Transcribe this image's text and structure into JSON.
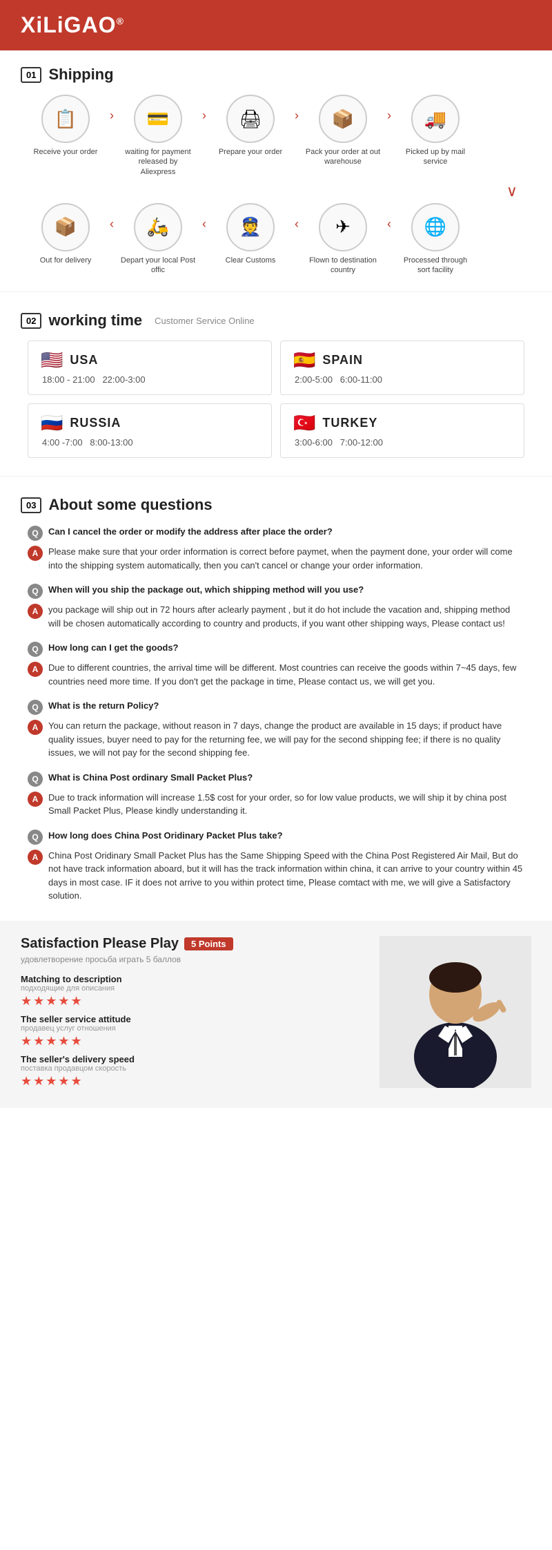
{
  "header": {
    "logo": "XiLiGAO",
    "reg": "®"
  },
  "shipping": {
    "section_num": "01",
    "section_label": "Shipping",
    "row1": [
      {
        "icon": "📋",
        "label": "Receive your order"
      },
      {
        "arrow": "›"
      },
      {
        "icon": "💳",
        "label": "waiting for payment released by Aliexpress"
      },
      {
        "arrow": "›"
      },
      {
        "icon": "🖨",
        "label": "Prepare your order"
      },
      {
        "arrow": "›"
      },
      {
        "icon": "📦",
        "label": "Pack your order at out warehouse"
      },
      {
        "arrow": "›"
      },
      {
        "icon": "🚚",
        "label": "Picked up by mail service"
      }
    ],
    "row2": [
      {
        "icon": "📦",
        "label": "Out for delivery"
      },
      {
        "arrow": "‹"
      },
      {
        "icon": "🛵",
        "label": "Depart your local Post offic"
      },
      {
        "arrow": "‹"
      },
      {
        "icon": "👮",
        "label": "Clear Customs"
      },
      {
        "arrow": "‹"
      },
      {
        "icon": "✈",
        "label": "Flown to destination country"
      },
      {
        "arrow": "‹"
      },
      {
        "icon": "🌐",
        "label": "Processed through sort facility"
      }
    ]
  },
  "working_time": {
    "section_num": "02",
    "section_label": "working time",
    "sublabel": "Customer Service Online",
    "countries": [
      {
        "flag": "🇺🇸",
        "name": "USA",
        "hours": "18:00 - 21:00   22:00-3:00"
      },
      {
        "flag": "🇪🇸",
        "name": "SPAIN",
        "hours": "2:00-5:00   6:00-11:00"
      },
      {
        "flag": "🇷🇺",
        "name": "RUSSIA",
        "hours": "4:00 -7:00   8:00-13:00"
      },
      {
        "flag": "🇹🇷",
        "name": "TURKEY",
        "hours": "3:00-6:00   7:00-12:00"
      }
    ]
  },
  "faq": {
    "section_num": "03",
    "section_label": "About some questions",
    "items": [
      {
        "q": "Can I cancel the order or modify the address after place the order?",
        "a": "Please make sure that your order information is correct before paymet, when the payment done, your order will come into the shipping system automatically, then you can't cancel or change your order information."
      },
      {
        "q": "When will you ship the package out, which shipping method will you use?",
        "a": "you package will ship out in 72 hours after aclearly payment , but it do hot include the vacation and, shipping method will be chosen automatically according to country and products, if you want other shipping ways, Please contact us!"
      },
      {
        "q": "How long can I get the goods?",
        "a": "Due to different countries, the arrival time will be different. Most countries can receive the goods within 7~45 days, few countries need more time. If you don't get the package in time, Please contact us, we will get you."
      },
      {
        "q": "What is the return Policy?",
        "a": "You can return the package, without reason in 7 days, change the product are available in 15 days; if product have quality issues, buyer need to pay for the returning fee, we will pay for the second shipping fee; if there is no quality issues, we will not pay for the second shipping fee."
      },
      {
        "q": "What is China Post ordinary Small Packet Plus?",
        "a": "Due to track information will increase 1.5$ cost for your order, so for low value products, we will ship it by china post Small Packet Plus, Please kindly understanding it."
      },
      {
        "q": "How long does China Post Oridinary Packet Plus take?",
        "a": "China Post Oridinary Small Packet Plus has the Same Shipping Speed with the China Post Registered Air Mail, But do not have track information aboard, but it will has the track information within china, it can arrive to your country within 45 days in most case. IF it does not arrive to you within protect time, Please comtact with me, we will give a Satisfactory solution."
      }
    ]
  },
  "satisfaction": {
    "title": "Satisfaction Please Play",
    "badge": "5 Points",
    "subtitle": "удовлетворение просьба играть 5 баллов",
    "ratings": [
      {
        "label": "Matching to description",
        "sublabel": "подходящие для описания",
        "stars": "★★★★★"
      },
      {
        "label": "The seller service attitude",
        "sublabel": "продавец услуг отношения",
        "stars": "★★★★★"
      },
      {
        "label": "The seller's delivery speed",
        "sublabel": "поставка продавцом скорость",
        "stars": "★★★★★"
      }
    ]
  }
}
